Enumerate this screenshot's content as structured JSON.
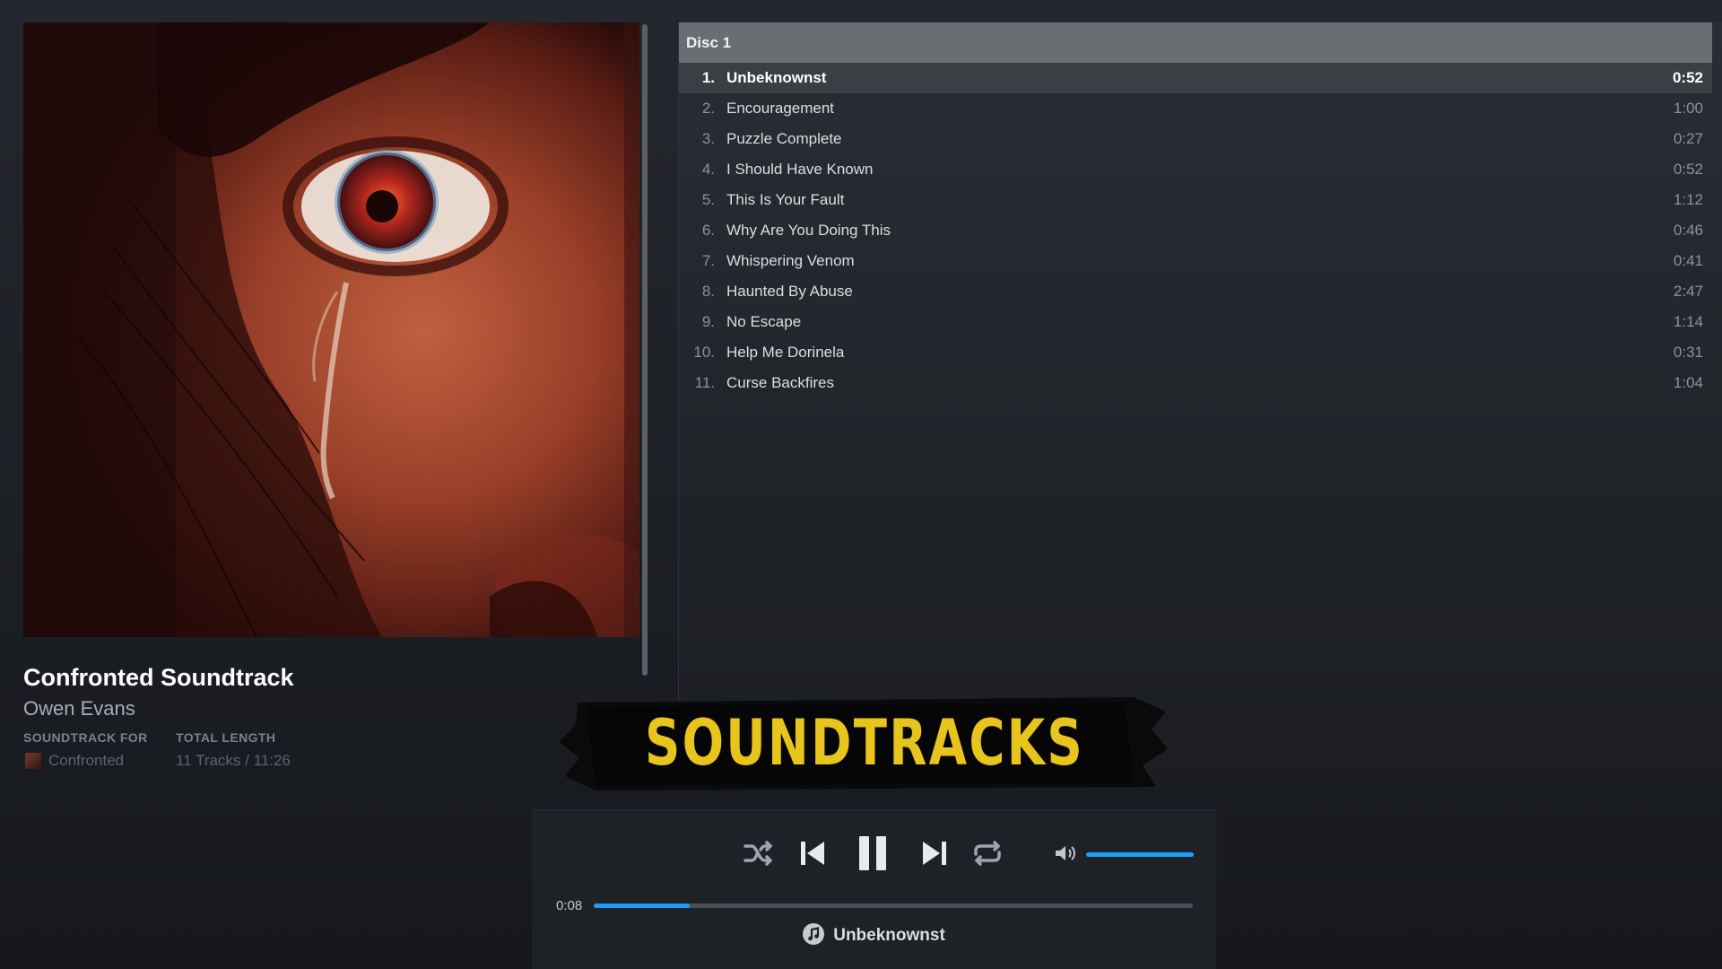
{
  "album": {
    "title": "Confronted Soundtrack",
    "artist": "Owen Evans",
    "soundtrack_for_label": "SOUNDTRACK FOR",
    "soundtrack_for_value": "Confronted",
    "total_length_label": "TOTAL LENGTH",
    "total_length_value": "11 Tracks / 11:26"
  },
  "tracklist": {
    "disc_label": "Disc 1",
    "tracks": [
      {
        "num": "1.",
        "title": "Unbeknownst",
        "duration": "0:52"
      },
      {
        "num": "2.",
        "title": "Encouragement",
        "duration": "1:00"
      },
      {
        "num": "3.",
        "title": "Puzzle Complete",
        "duration": "0:27"
      },
      {
        "num": "4.",
        "title": "I Should Have Known",
        "duration": "0:52"
      },
      {
        "num": "5.",
        "title": "This Is Your Fault",
        "duration": "1:12"
      },
      {
        "num": "6.",
        "title": "Why Are You Doing This",
        "duration": "0:46"
      },
      {
        "num": "7.",
        "title": "Whispering Venom",
        "duration": "0:41"
      },
      {
        "num": "8.",
        "title": "Haunted By Abuse",
        "duration": "2:47"
      },
      {
        "num": "9.",
        "title": "No Escape",
        "duration": "1:14"
      },
      {
        "num": "10.",
        "title": "Help Me Dorinela",
        "duration": "0:31"
      },
      {
        "num": "11.",
        "title": "Curse Backfires",
        "duration": "1:04"
      }
    ],
    "active_index": 0
  },
  "banner": {
    "text": "SOUNDTRACKS",
    "color": "#e7c51c"
  },
  "player": {
    "elapsed": "0:08",
    "progress_fraction": 0.16,
    "volume_fraction": 1.0,
    "now_playing": "Unbeknownst",
    "accent_color": "#1a9fff",
    "icons": [
      "shuffle-icon",
      "previous-icon",
      "pause-icon",
      "next-icon",
      "repeat-icon",
      "volume-icon",
      "music-note-icon"
    ]
  }
}
